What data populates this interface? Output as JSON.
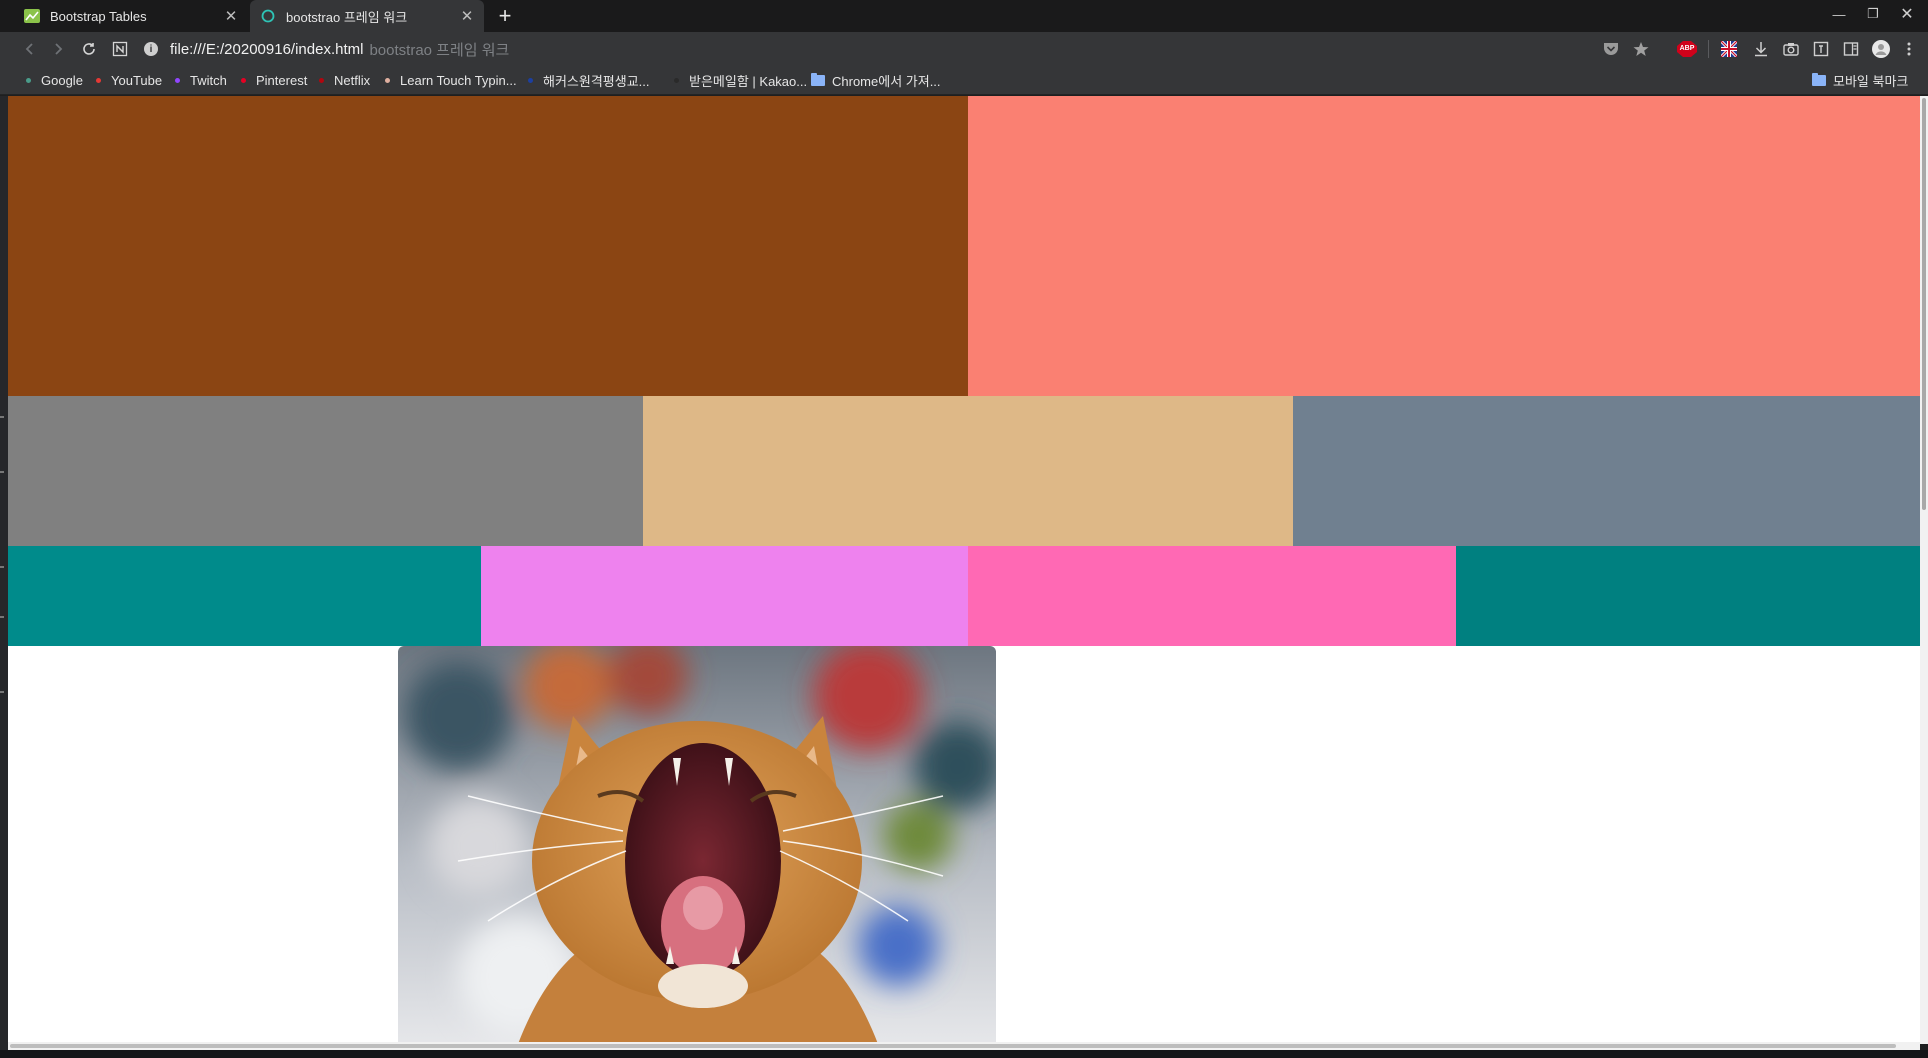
{
  "browser": {
    "tabs": [
      {
        "title": "Bootstrap Tables",
        "active": false,
        "favicon": "chart-favicon-icon"
      },
      {
        "title": "bootstrao 프레임 워크",
        "active": true,
        "favicon": "ring-favicon-icon"
      }
    ],
    "new_tab_label": "+",
    "address": {
      "url": "file:///E:/20200916/index.html",
      "page_title": "bootstrao 프레임 워크"
    },
    "extensions": [
      "pocket-icon",
      "star-icon",
      "adblock-icon",
      "flag-uk-icon",
      "download-icon",
      "camera-icon",
      "reader-icon",
      "sidebar-icon",
      "profile-icon",
      "menu-icon"
    ],
    "adblock_label": "ABP",
    "bookmarks": [
      {
        "label": "Google",
        "dot": "#4a9c8a"
      },
      {
        "label": "YouTube",
        "dot": "#e53935"
      },
      {
        "label": "Twitch",
        "dot": "#9146ff"
      },
      {
        "label": "Pinterest",
        "dot": "#e60023"
      },
      {
        "label": "Netflix",
        "dot": "#b1060f"
      },
      {
        "label": "Learn Touch Typin...",
        "dot": "#e0b0a0"
      },
      {
        "label": "해커스원격평생교...",
        "dot": "#1c3fa0"
      },
      {
        "label": "받은메일함 | Kakao...",
        "dot": "#2a2a2a"
      },
      {
        "label": "Chrome에서 가져...",
        "folder": true
      }
    ],
    "mobile_bookmarks": "모바일 북마크"
  },
  "page": {
    "rows": [
      {
        "colors": [
          "#8b4513",
          "#fa8072"
        ]
      },
      {
        "colors": [
          "#808080",
          "#deb887",
          "#708090"
        ]
      },
      {
        "colors": [
          "#008b8b",
          "#ee82ee",
          "#ff69b4",
          "#008080"
        ]
      }
    ],
    "image_subject": "yawning-cat"
  }
}
